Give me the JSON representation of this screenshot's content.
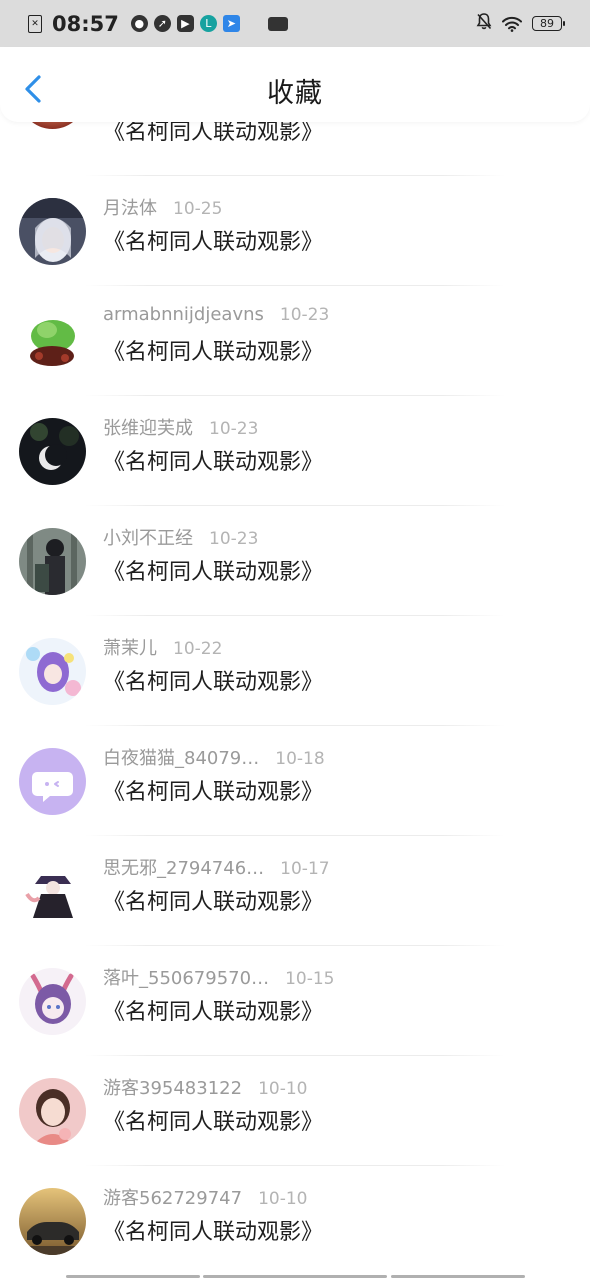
{
  "status_bar": {
    "time": "08:57",
    "battery": "89"
  },
  "header": {
    "title": "收藏"
  },
  "items": [
    {
      "username": "",
      "date": "",
      "title": "《名柯同人联动观影》",
      "avatar_colors": [
        "#f2cfc6",
        "#b8482e"
      ]
    },
    {
      "username": "月法体",
      "date": "10-25",
      "title": "《名柯同人联动观影》",
      "avatar_colors": [
        "#d9dee8",
        "#5b6275"
      ]
    },
    {
      "username": "armabnnijdjeavns",
      "date": "10-23",
      "title": "《名柯同人联动观影》",
      "avatar_colors": [
        "#5fb944",
        "#6b2a22"
      ]
    },
    {
      "username": "张维迎芙成",
      "date": "10-23",
      "title": "《名柯同人联动观影》",
      "avatar_colors": [
        "#2b2b34",
        "#0f1114"
      ]
    },
    {
      "username": "小刘不正经",
      "date": "10-23",
      "title": "《名柯同人联动观影》",
      "avatar_colors": [
        "#8d9690",
        "#2b2d30"
      ]
    },
    {
      "username": "萧茉儿",
      "date": "10-22",
      "title": "《名柯同人联动观影》",
      "avatar_colors": [
        "#d6c6f2",
        "#7b5bc7"
      ]
    },
    {
      "username": "白夜猫猫_84079…",
      "date": "10-18",
      "title": "《名柯同人联动观影》",
      "avatar_colors": [
        "#c7b3f1",
        "#c7b3f1"
      ]
    },
    {
      "username": "思无邪_2794746…",
      "date": "10-17",
      "title": "《名柯同人联动观影》",
      "avatar_colors": [
        "#f5f5f5",
        "#2d2438"
      ]
    },
    {
      "username": "落叶_550679570…",
      "date": "10-15",
      "title": "《名柯同人联动观影》",
      "avatar_colors": [
        "#f1e9f4",
        "#8460a8"
      ]
    },
    {
      "username": "游客395483122",
      "date": "10-10",
      "title": "《名柯同人联动观影》",
      "avatar_colors": [
        "#f0c2c4",
        "#e7948e"
      ]
    },
    {
      "username": "游客562729747",
      "date": "10-10",
      "title": "《名柯同人联动观影》",
      "avatar_colors": [
        "#d9a95a",
        "#34312c"
      ]
    }
  ],
  "colors": {
    "back_arrow": "#2f8fe8",
    "username": "#9a9a9a",
    "date": "#b4b4b4",
    "title": "#1e1e1e"
  }
}
